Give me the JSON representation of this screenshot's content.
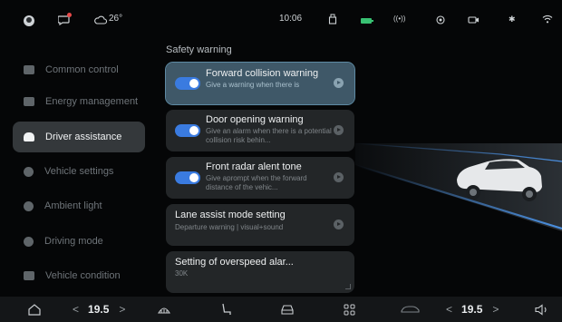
{
  "status_bar": {
    "weather_temp": "26°",
    "time": "10:06"
  },
  "sidebar": {
    "items": [
      {
        "label": "Common control",
        "icon": "grid-icon"
      },
      {
        "label": "Energy management",
        "icon": "battery-icon"
      },
      {
        "label": "Driver assistance",
        "icon": "car-front-icon",
        "active": true
      },
      {
        "label": "Vehicle settings",
        "icon": "settings-icon"
      },
      {
        "label": "Ambient light",
        "icon": "light-icon"
      },
      {
        "label": "Driving mode",
        "icon": "steering-icon"
      },
      {
        "label": "Vehicle condition",
        "icon": "chart-icon"
      }
    ]
  },
  "main": {
    "section_title": "Safety warning",
    "cards": [
      {
        "title": "Forward collision warning",
        "subtitle": "Give a warning when there is",
        "toggle_on": true,
        "selected": true
      },
      {
        "title": "Door opening warning",
        "subtitle": "Give an alarm when there is a potential collision risk behin...",
        "toggle_on": true
      },
      {
        "title": "Front radar alent tone",
        "subtitle": "Give aprompt when the forward distance of the vehic...",
        "toggle_on": true
      },
      {
        "title": "Lane assist mode setting",
        "subtitle": "Departure warning | visual+sound"
      },
      {
        "title": "Setting of overspeed alar...",
        "subtitle": "30K"
      }
    ]
  },
  "dock": {
    "left_temp": "19.5",
    "right_temp": "19.5",
    "chevron_left": "<",
    "chevron_right": ">"
  },
  "colors": {
    "accent": "#3a7be0",
    "selected_card": "#3f5868",
    "battery": "#38c172",
    "lane_glow": "#4a90e2"
  }
}
